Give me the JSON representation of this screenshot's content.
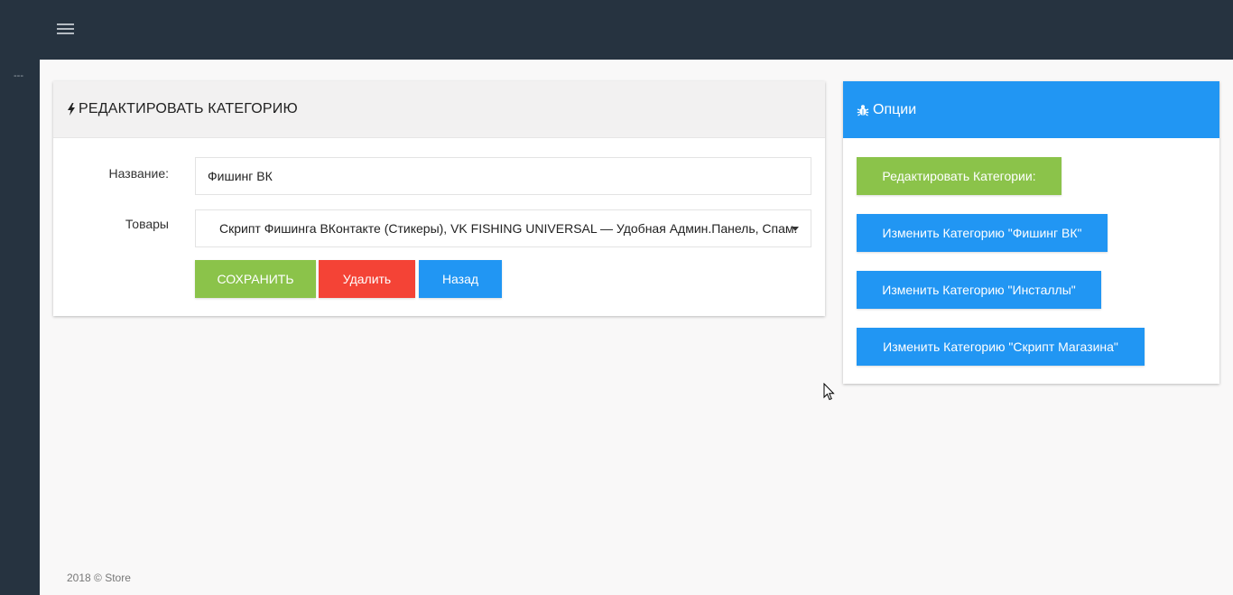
{
  "topbar": {
    "menu_icon": "hamburger-menu-icon"
  },
  "sidebar": {
    "collapsed_label": "---"
  },
  "edit_card": {
    "title": "РЕДАКТИРОВАТЬ КАТЕГОРИЮ",
    "title_icon": "bolt-icon",
    "name_label": "Название:",
    "name_value": "Фишинг ВК",
    "products_label": "Товары",
    "products_selected": "Скрипт Фишинга ВКонтакте (Стикеры), VK FISHING UNIVERSAL — Удобная Админ.Панель, Спам.",
    "save_label": "СОХРАНИТЬ",
    "delete_label": "Удалить",
    "back_label": "Назад"
  },
  "options_card": {
    "title": "Опции",
    "title_icon": "bug-icon",
    "buttons": [
      {
        "label": "Редактировать Категории:",
        "color": "#8bc34a"
      },
      {
        "label": "Изменить Категорию \"Фишинг ВК\"",
        "color": "#2196f3"
      },
      {
        "label": "Изменить Категорию \"Инсталлы\"",
        "color": "#2196f3"
      },
      {
        "label": "Изменить Категорию \"Скрипт Магазина\"",
        "color": "#2196f3"
      }
    ]
  },
  "footer": {
    "text": "2018 © Store"
  },
  "colors": {
    "topbar": "#263340",
    "green": "#8bc34a",
    "red": "#f44336",
    "blue": "#2196f3"
  }
}
